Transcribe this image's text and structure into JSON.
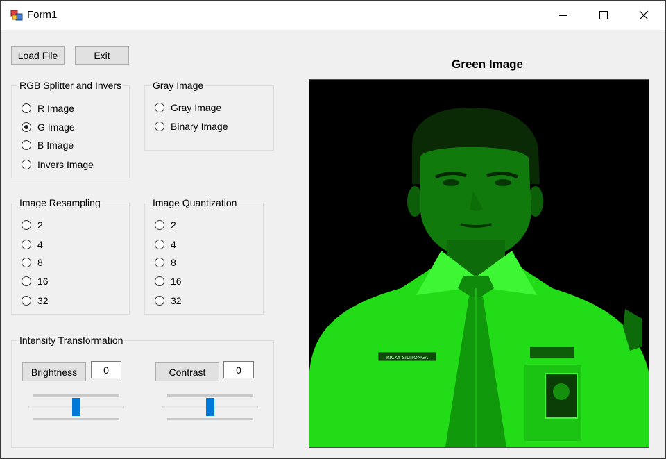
{
  "window": {
    "title": "Form1"
  },
  "toolbar": {
    "load_label": "Load File",
    "exit_label": "Exit"
  },
  "rgb_group": {
    "legend": "RGB Splitter and Invers",
    "options": [
      {
        "label": "R Image",
        "checked": false
      },
      {
        "label": "G Image",
        "checked": true
      },
      {
        "label": "B Image",
        "checked": false
      },
      {
        "label": "Invers Image",
        "checked": false
      }
    ]
  },
  "gray_group": {
    "legend": "Gray Image",
    "options": [
      {
        "label": "Gray Image",
        "checked": false
      },
      {
        "label": "Binary Image",
        "checked": false
      }
    ]
  },
  "resampling_group": {
    "legend": "Image Resampling",
    "options": [
      {
        "label": "2",
        "checked": false
      },
      {
        "label": "4",
        "checked": false
      },
      {
        "label": "8",
        "checked": false
      },
      {
        "label": "16",
        "checked": false
      },
      {
        "label": "32",
        "checked": false
      }
    ]
  },
  "quantization_group": {
    "legend": "Image Quantization",
    "options": [
      {
        "label": "2",
        "checked": false
      },
      {
        "label": "4",
        "checked": false
      },
      {
        "label": "8",
        "checked": false
      },
      {
        "label": "16",
        "checked": false
      },
      {
        "label": "32",
        "checked": false
      }
    ]
  },
  "intensity_group": {
    "legend": "Intensity Transformation",
    "brightness": {
      "label": "Brightness",
      "value": "0",
      "slider_level": 0.5
    },
    "contrast": {
      "label": "Contrast",
      "value": "0",
      "slider_level": 0.5
    }
  },
  "image_panel": {
    "title": "Green Image",
    "name_tag": "RICKY SILITONGA",
    "tint_color": "#00ff00"
  },
  "colors": {
    "accent": "#0078d7",
    "window_bg": "#f0f0f0",
    "button_bg": "#e1e1e1"
  }
}
